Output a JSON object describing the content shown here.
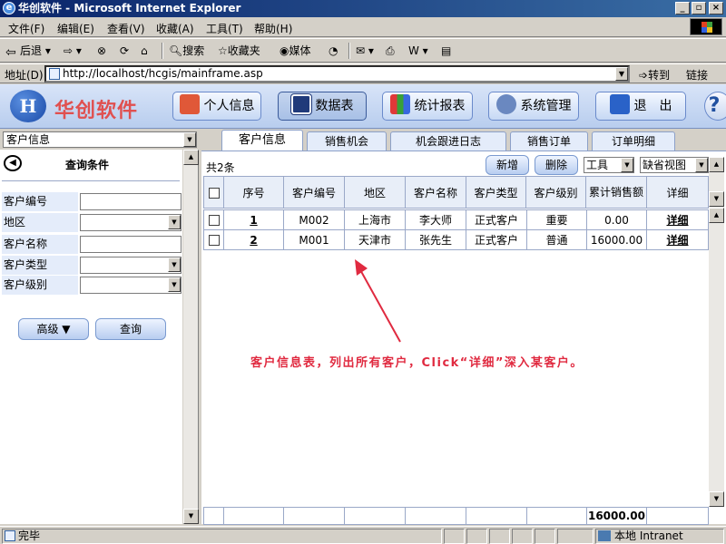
{
  "window": {
    "title": "华创软件 - Microsoft Internet Explorer",
    "min": "_",
    "max": "▫",
    "close": "×"
  },
  "menubar": [
    "文件(F)",
    "编辑(E)",
    "查看(V)",
    "收藏(A)",
    "工具(T)",
    "帮助(H)"
  ],
  "toolbar": {
    "back": "后退",
    "search": "搜索",
    "favorites": "收藏夹",
    "media": "媒体"
  },
  "address": {
    "label": "地址(D)",
    "url": "http://localhost/hcgis/mainframe.asp",
    "go": "转到",
    "links": "链接"
  },
  "app": {
    "logo_text": "华创软件",
    "nav": [
      "个人信息",
      "数据表",
      "统计报表",
      "系统管理",
      "退　出"
    ],
    "help": "?"
  },
  "left": {
    "table_select": "客户信息",
    "panel_title": "查询条件",
    "fields": [
      "客户编号",
      "地区",
      "客户名称",
      "客户类型",
      "客户级别"
    ],
    "advanced": "高级 ▼",
    "query": "查询"
  },
  "tabs": [
    "客户信息",
    "销售机会",
    "机会跟进日志",
    "销售订单",
    "订单明细"
  ],
  "main": {
    "count": "共2条",
    "add": "新增",
    "delete": "删除",
    "tools": "工具",
    "view": "缺省视图",
    "columns": [
      "序号",
      "客户编号",
      "地区",
      "客户名称",
      "客户类型",
      "客户级别",
      "累计销售额",
      "详细"
    ],
    "rows": [
      [
        "1",
        "M002",
        "上海市",
        "李大师",
        "正式客户",
        "重要",
        "0.00",
        "详细"
      ],
      [
        "2",
        "M001",
        "天津市",
        "张先生",
        "正式客户",
        "普通",
        "16000.00",
        "详细"
      ]
    ],
    "total": "16000.00",
    "annotation": "客户信息表，列出所有客户，Click“详细”深入某客户。"
  },
  "status": {
    "text": "完毕",
    "zone": "本地 Intranet"
  }
}
